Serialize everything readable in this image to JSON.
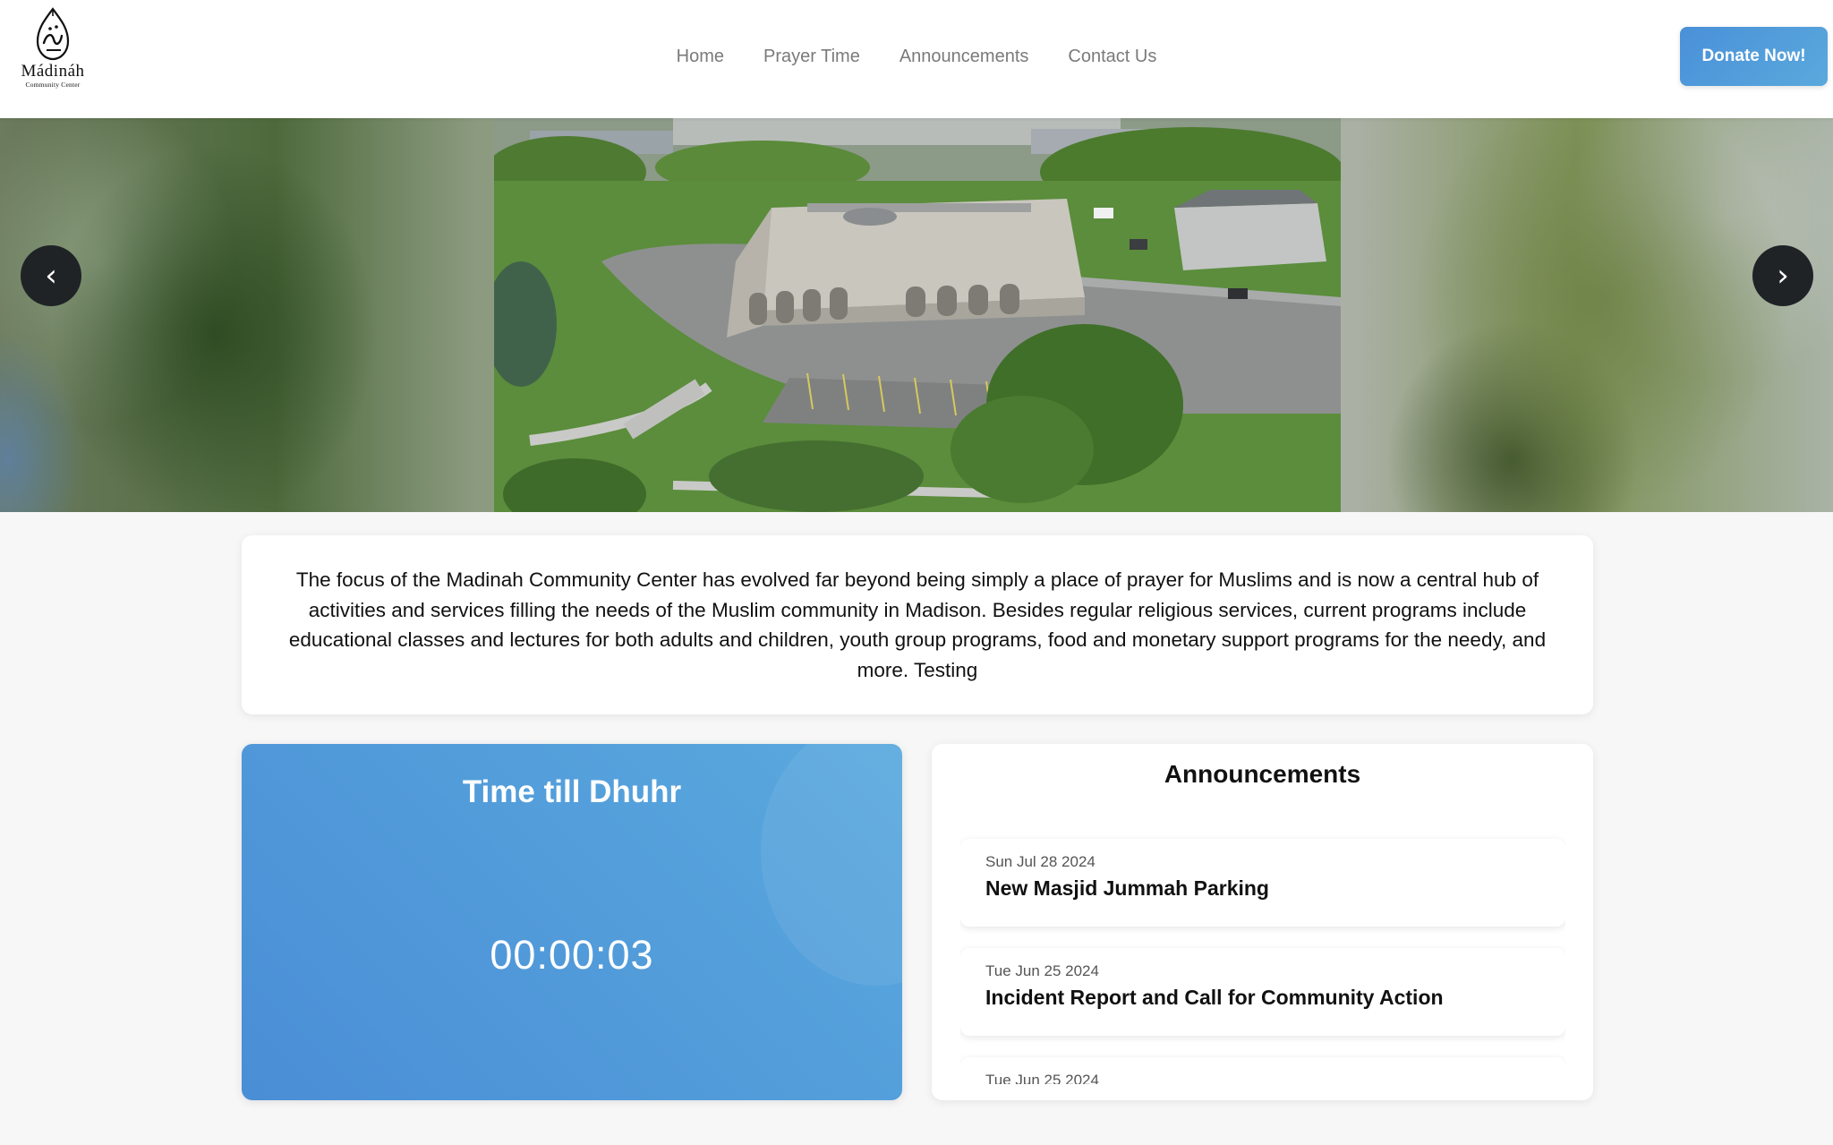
{
  "logo": {
    "name": "Mádináh",
    "subtitle": "Community Center"
  },
  "nav": {
    "items": [
      "Home",
      "Prayer Time",
      "Announcements",
      "Contact Us"
    ]
  },
  "header": {
    "donate_label": "Donate Now!"
  },
  "carousel": {
    "prev_label": "‹",
    "next_label": "›"
  },
  "about": {
    "text": "The focus of the Madinah Community Center has evolved far beyond being simply a place of prayer for Muslims and is now a central hub of activities and services filling the needs of the Muslim community in Madison. Besides regular religious services, current programs include educational classes and lectures for both adults and children, youth group programs, food and monetary support programs for the needy, and more. Testing"
  },
  "countdown": {
    "title": "Time till Dhuhr",
    "timer": "00:00:03"
  },
  "announcements": {
    "title": "Announcements",
    "items": [
      {
        "date": "Sun Jul 28 2024",
        "title": "New Masjid Jummah Parking"
      },
      {
        "date": "Tue Jun 25 2024",
        "title": "Incident Report and Call for Community Action"
      },
      {
        "date": "Tue Jun 25 2024",
        "title": ""
      }
    ]
  },
  "colors": {
    "accent": "#4a90d9",
    "accent_light": "#5aa9dc",
    "carousel_button": "#1f2326",
    "nav_text": "#7a7a7a"
  }
}
